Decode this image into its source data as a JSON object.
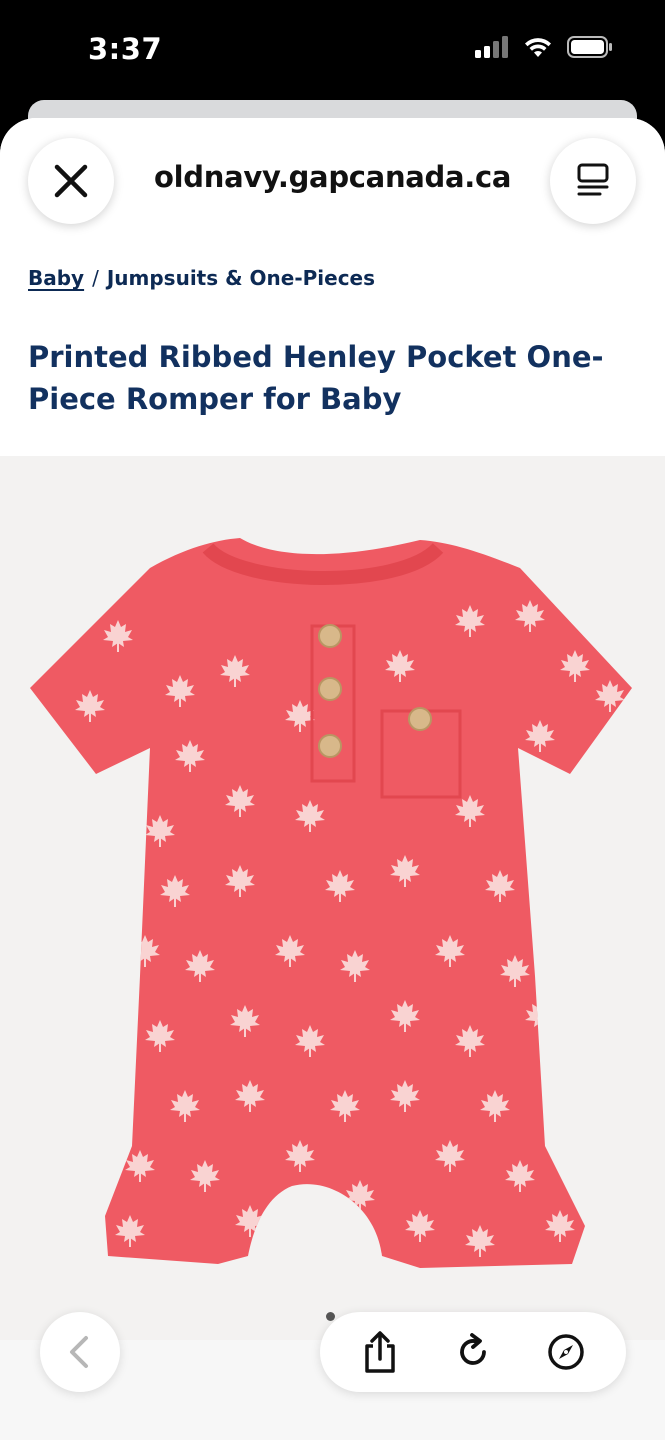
{
  "status_bar": {
    "time": "3:37",
    "icons": [
      "cellular-signal-icon",
      "wifi-icon",
      "battery-icon"
    ]
  },
  "browser": {
    "url": "oldnavy.gapcanada.ca",
    "close_icon": "close-icon",
    "reader_icon": "reader-view-icon"
  },
  "breadcrumb": {
    "items": [
      "Baby",
      "Jumpsuits & One-Pieces"
    ],
    "separator": "/"
  },
  "product": {
    "title": "Printed Ribbed Henley Pocket One-Piece Romper for Baby",
    "image_alt": "Pink romper with white maple leaf print",
    "garment_color": "#ef5a63",
    "leaf_color": "#f9d3d2"
  },
  "carousel": {
    "current": 1
  },
  "toolbar": {
    "buttons": [
      "back-icon",
      "share-icon",
      "reload-icon",
      "compass-icon"
    ]
  }
}
